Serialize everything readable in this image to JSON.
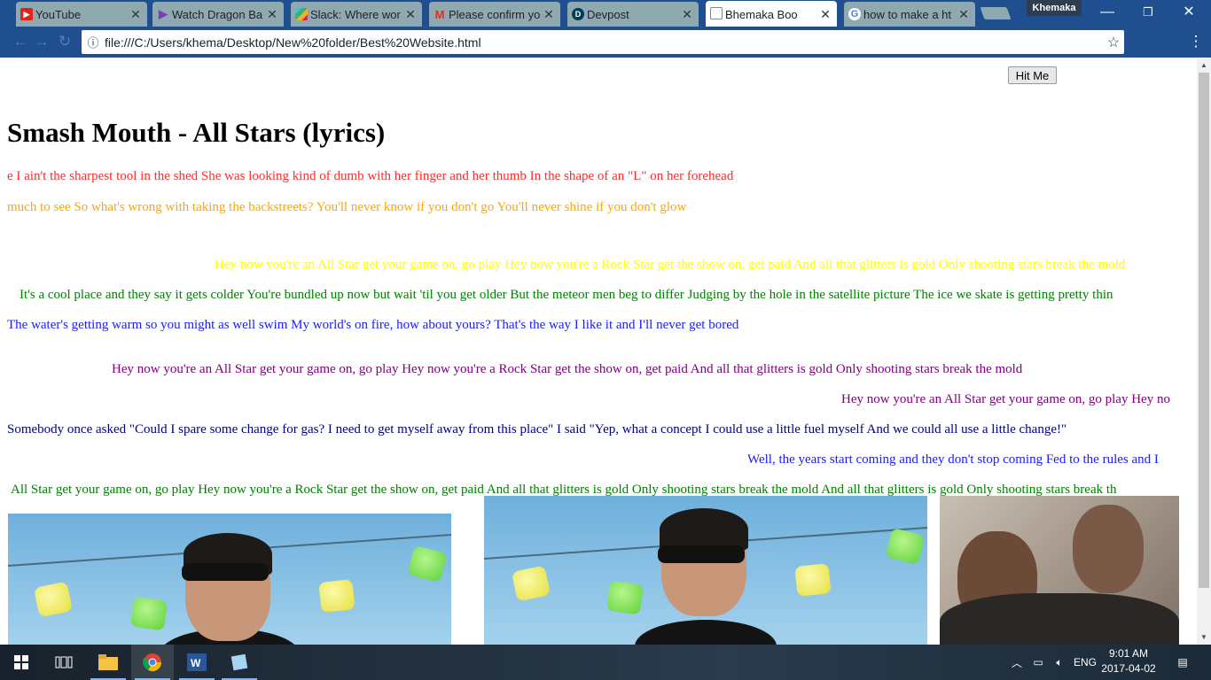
{
  "browser": {
    "tabs": [
      {
        "title": "YouTube",
        "favicon": "youtube-icon",
        "color": "#e62117"
      },
      {
        "title": "Watch Dragon Ba",
        "favicon": "play-icon",
        "color": "#7b3fb5"
      },
      {
        "title": "Slack: Where wor",
        "favicon": "slack-icon",
        "color": "#4a154b"
      },
      {
        "title": "Please confirm yo",
        "favicon": "gmail-icon",
        "color": "#d93025"
      },
      {
        "title": "Devpost",
        "favicon": "devpost-icon",
        "color": "#003e54"
      },
      {
        "title": "Bhemaka Boo",
        "favicon": "blank-page-icon",
        "color": "#ffffff"
      },
      {
        "title": "how to make a ht",
        "favicon": "google-icon",
        "color": "#4285f4"
      }
    ],
    "profile": "Khemaka",
    "address_url": "file:///C:/Users/khema/Desktop/New%20folder/Best%20Website.html"
  },
  "page": {
    "button_label": "Hit Me",
    "heading": "Smash Mouth - All Stars (lyrics)",
    "marquees": [
      {
        "text": "e I ain't the sharpest tool in the shed She was looking kind of dumb with her finger and her thumb In the shape of an \"L\" on her forehead",
        "color": "#ff2b2b"
      },
      {
        "text": "much to see So what's wrong with taking the backstreets? You'll never know if you don't go You'll never shine if you don't glow",
        "color": "#ffa500"
      },
      {
        "text": "Hey now you're an All Star get your game on, go play Hey now you're a Rock Star get the show on, get paid And all that glitters is gold Only shooting stars break the mold",
        "color": "#ffff00"
      },
      {
        "text": "It's a cool place and they say it gets colder You're bundled up now but wait 'til you get older But the meteor men beg to differ Judging by the hole in the satellite picture The ice we skate is getting pretty thin",
        "color": "#008000"
      },
      {
        "text": "The water's getting warm so you might as well swim My world's on fire, how about yours? That's the way I like it and I'll never get bored",
        "color": "#1a1aff"
      },
      {
        "text": "Hey now you're an All Star get your game on, go play Hey now you're a Rock Star get the show on, get paid And all that glitters is gold Only shooting stars break the mold",
        "color": "#800080"
      },
      {
        "text": "Hey now you're an All Star get your game on, go play Hey no",
        "color": "#800080"
      },
      {
        "text": "Somebody once asked \"Could I spare some change for gas? I need to get myself away from this place\" I said \"Yep, what a concept I could use a little fuel myself And we could all use a little change!\"",
        "color": "#000080"
      },
      {
        "text": "Well, the years start coming and they don't stop coming Fed to the rules and I",
        "color": "#1a1aff"
      },
      {
        "text": "All Star get your game on, go play Hey now you're a Rock Star get the show on, get paid And all that glitters is gold Only shooting stars break the mold And all that glitters is gold Only shooting stars break th",
        "color": "#008000"
      }
    ]
  },
  "taskbar": {
    "language": "ENG",
    "time": "9:01 AM",
    "date": "2017-04-02"
  }
}
